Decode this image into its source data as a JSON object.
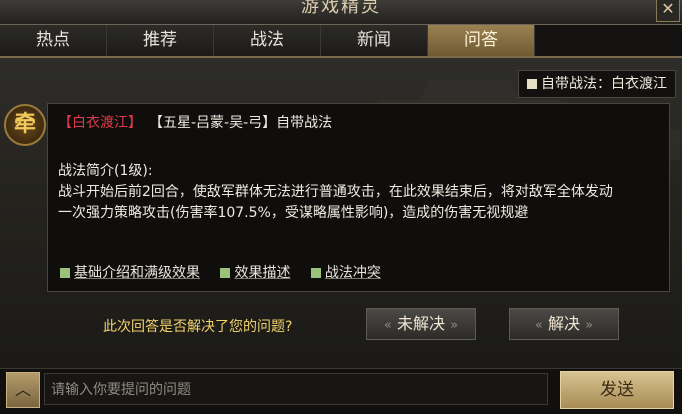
{
  "window": {
    "title": "游戏精灵",
    "close_label": "✕"
  },
  "tabs": [
    {
      "label": "热点"
    },
    {
      "label": "推荐"
    },
    {
      "label": "战法"
    },
    {
      "label": "新闻"
    },
    {
      "label": "问答",
      "active": true
    }
  ],
  "badge": {
    "label": "自带战法：白衣渡江"
  },
  "card": {
    "avatar_glyph": "牵",
    "name_tag": "【白衣渡江】",
    "general": "【五星-吕蒙-吴-弓】自带战法",
    "intro": "战法简介(1级):",
    "desc_line1": "战斗开始后前2回合，使敌军群体无法进行普通攻击，在此效果结束后，将对敌军全体发动",
    "desc_line2": "一次强力策略攻击(伤害率107.5%，受谋略属性影响)，造成的伤害无视规避",
    "links": [
      "基础介绍和满级效果",
      "效果描述",
      "战法冲突"
    ]
  },
  "feedback": {
    "question": "此次回答是否解决了您的问题?",
    "unsolved": "未解决",
    "solved": "解决"
  },
  "composer": {
    "toggle": "︿",
    "placeholder": "请输入你要提问的问题",
    "send": "发送"
  },
  "colors": {
    "accent_gold": "#9a8152",
    "name_red": "#e0394a",
    "question_yellow": "#f1d26b"
  }
}
